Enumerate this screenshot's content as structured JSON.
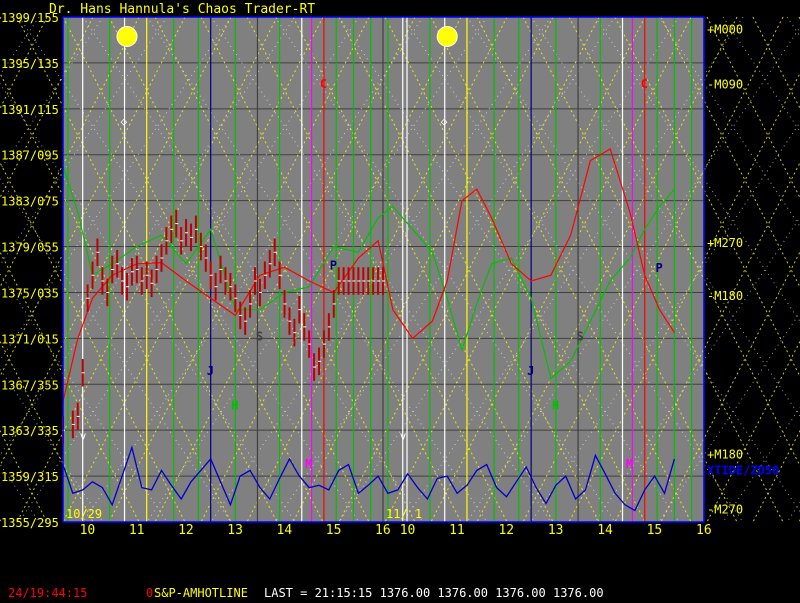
{
  "app": {
    "title": "Dr. Hans Hannula's Chaos Trader-RT"
  },
  "colors": {
    "background": "#000000",
    "plot_bg": "#808080",
    "price_label": "#ffff00",
    "price_line": "#ffffff",
    "price_bars": "#c00000",
    "red_curve": "#ff0000",
    "green_curve": "#00c000",
    "tide_curve": "#0000cc",
    "grid_yellow": "#ffff00",
    "grid_white": "#ffffff",
    "axis_blue": "#0000ff",
    "green_vline": "#00c000",
    "magenta_vline": "#ff00ff",
    "red_vline": "#ff0000",
    "navy_vline": "#000080",
    "dark_vline": "#404040"
  },
  "chart_data": {
    "type": "line",
    "ylim": [
      1355,
      1399
    ],
    "y_tick_labels": [
      "1399/155",
      "1395/135",
      "1391/115",
      "1387/095",
      "1383/075",
      "1379/055",
      "1375/035",
      "1371/015",
      "1367/355",
      "1363/335",
      "1359/315",
      "1355/295"
    ],
    "y_tick_values": [
      1399,
      1395,
      1391,
      1387,
      1383,
      1379,
      1375,
      1371,
      1367,
      1363,
      1359,
      1355
    ],
    "x_date_labels": [
      "10/29",
      "11/ 1"
    ],
    "x_hour_labels": [
      "10",
      "11",
      "12",
      "13",
      "14",
      "15",
      "16",
      "10",
      "11",
      "12",
      "13",
      "14",
      "15",
      "16"
    ],
    "right_labels": [
      {
        "text": "+M000",
        "price": 1397.9
      },
      {
        "text": "-M090",
        "price": 1393.1
      },
      {
        "text": "+M270",
        "price": 1379.3
      },
      {
        "text": "-M180",
        "price": 1374.7
      },
      {
        "text": "+M180",
        "price": 1360.9
      },
      {
        "text": "XTIDE/ZD50",
        "price": 1359.5
      },
      {
        "text": "-M270",
        "price": 1356.1
      }
    ],
    "markers": [
      {
        "text": "C",
        "x": 14.8,
        "price": 1392.8,
        "color": "#ff0000"
      },
      {
        "text": "P",
        "x": 15.0,
        "price": 1377.0,
        "color": "#000080"
      },
      {
        "text": "S",
        "x": 13.5,
        "price": 1370.8,
        "color": "#404040"
      },
      {
        "text": "J",
        "x": 12.5,
        "price": 1367.8,
        "color": "#000080"
      },
      {
        "text": "H",
        "x": 13.0,
        "price": 1364.8,
        "color": "#00c000"
      },
      {
        "text": "M",
        "x": 14.5,
        "price": 1359.7,
        "color": "#ff00ff"
      },
      {
        "text": "C",
        "x": 14.8,
        "price": 1392.8,
        "color": "#ff0000",
        "day": 2
      },
      {
        "text": "P",
        "x": 15.1,
        "price": 1376.8,
        "color": "#000080",
        "day": 2
      },
      {
        "text": "S",
        "x": 13.5,
        "price": 1370.8,
        "color": "#404040",
        "day": 2
      },
      {
        "text": "J",
        "x": 12.5,
        "price": 1367.8,
        "color": "#000080",
        "day": 2
      },
      {
        "text": "H",
        "x": 13.0,
        "price": 1364.8,
        "color": "#00c000",
        "day": 2
      },
      {
        "text": "M",
        "x": 14.5,
        "price": 1359.7,
        "color": "#ff00ff",
        "day": 2
      }
    ],
    "moon_phases": [
      {
        "x": 10.8,
        "price": 1397.3
      },
      {
        "x": 10.8,
        "price": 1397.3,
        "day": 2
      }
    ],
    "series": [
      {
        "name": "price",
        "x": [
          9.5,
          9.7,
          9.8,
          9.9,
          10.0,
          10.1,
          10.2,
          10.3,
          10.4,
          10.5,
          10.6,
          10.7,
          10.8,
          10.9,
          11.0,
          11.1,
          11.2,
          11.3,
          11.4,
          11.5,
          11.6,
          11.7,
          11.8,
          11.9,
          12.0,
          12.1,
          12.2,
          12.3,
          12.4,
          12.5,
          12.6,
          12.7,
          12.8,
          12.9,
          13.0,
          13.1,
          13.2,
          13.3,
          13.4,
          13.5,
          13.6,
          13.7,
          13.8,
          13.9,
          14.0,
          14.1,
          14.2,
          14.3,
          14.4,
          14.5,
          14.6,
          14.7,
          14.8,
          14.9,
          15.0,
          15.1,
          15.2,
          15.3,
          15.4,
          15.5,
          15.6,
          15.7,
          15.8,
          15.9,
          16.0
        ],
        "values": [
          1363.0,
          1363.5,
          1364.2,
          1368.0,
          1374.5,
          1376.5,
          1378.5,
          1376.0,
          1375.0,
          1377.0,
          1377.5,
          1376.0,
          1375.5,
          1376.8,
          1377.0,
          1376.0,
          1376.5,
          1375.8,
          1377.0,
          1378.0,
          1379.5,
          1380.5,
          1381.0,
          1379.5,
          1380.2,
          1379.8,
          1380.5,
          1379.0,
          1378.0,
          1376.5,
          1375.5,
          1377.0,
          1376.0,
          1375.5,
          1374.5,
          1373.0,
          1372.5,
          1374.0,
          1376.0,
          1375.0,
          1376.5,
          1377.5,
          1378.5,
          1376.5,
          1374.0,
          1372.5,
          1371.5,
          1373.5,
          1372.0,
          1370.5,
          1368.5,
          1369.0,
          1370.5,
          1372.0,
          1374.0,
          1376.0,
          1376.0,
          1376.0,
          1376.0,
          1376.0,
          1376.0,
          1376.0,
          1376.0,
          1376.0,
          1376.0
        ]
      },
      {
        "name": "red-cycle",
        "x": [
          9.5,
          9.8,
          10.1,
          10.5,
          11.0,
          11.5,
          12.0,
          12.5,
          13.0,
          13.5,
          14.0,
          14.5,
          15.0,
          15.5,
          15.9,
          16.2,
          16.6,
          17.0,
          17.3,
          17.6,
          17.9,
          18.2,
          18.6,
          19.0,
          19.4,
          19.8,
          20.2,
          20.6,
          21.0,
          21.3,
          21.6,
          21.9
        ],
        "values": [
          1365.5,
          1371.0,
          1374.5,
          1376.5,
          1377.5,
          1377.6,
          1376.0,
          1374.5,
          1373.0,
          1376.5,
          1377.2,
          1376.0,
          1375.0,
          1378.0,
          1379.5,
          1373.5,
          1371.0,
          1372.5,
          1376.0,
          1383.0,
          1384.0,
          1381.5,
          1377.5,
          1376.0,
          1376.5,
          1380.0,
          1386.5,
          1387.5,
          1382.0,
          1376.5,
          1373.5,
          1371.5
        ]
      },
      {
        "name": "green-cycle",
        "x": [
          9.5,
          9.8,
          10.1,
          10.5,
          11.0,
          11.5,
          12.0,
          12.5,
          13.0,
          13.5,
          14.0,
          14.5,
          15.0,
          15.5,
          15.9,
          16.2,
          16.6,
          17.0,
          17.3,
          17.6,
          17.9,
          18.2,
          18.6,
          19.0,
          19.4,
          19.8,
          20.2,
          20.6,
          21.0,
          21.3,
          21.6,
          21.9
        ],
        "values": [
          1386.0,
          1382.0,
          1376.5,
          1377.5,
          1379.0,
          1380.0,
          1377.5,
          1380.5,
          1373.5,
          1373.5,
          1375.0,
          1375.5,
          1379.0,
          1378.5,
          1381.5,
          1382.5,
          1380.5,
          1378.5,
          1374.5,
          1370.0,
          1374.0,
          1377.5,
          1378.0,
          1374.5,
          1367.5,
          1369.0,
          1372.5,
          1376.0,
          1378.0,
          1380.5,
          1382.5,
          1384.0
        ]
      },
      {
        "name": "tide",
        "x": [
          9.5,
          9.7,
          9.9,
          10.1,
          10.3,
          10.5,
          10.7,
          10.9,
          11.1,
          11.3,
          11.5,
          11.7,
          11.9,
          12.1,
          12.3,
          12.5,
          12.7,
          12.9,
          13.1,
          13.3,
          13.5,
          13.7,
          13.9,
          14.1,
          14.3,
          14.5,
          14.7,
          14.9,
          15.1,
          15.3,
          15.5,
          15.7,
          15.9,
          16.1,
          16.3,
          16.5,
          16.7,
          16.9,
          17.1,
          17.3,
          17.5,
          17.7,
          17.9,
          18.1,
          18.3,
          18.5,
          18.7,
          18.9,
          19.1,
          19.3,
          19.5,
          19.7,
          19.9,
          20.1,
          20.3,
          20.5,
          20.7,
          20.9,
          21.1,
          21.3,
          21.5,
          21.7,
          21.9
        ],
        "values": [
          1360.0,
          1357.5,
          1357.8,
          1358.5,
          1358.0,
          1356.5,
          1359.0,
          1361.5,
          1358.0,
          1357.8,
          1359.5,
          1358.2,
          1357.0,
          1358.5,
          1359.5,
          1360.5,
          1358.5,
          1356.5,
          1359.0,
          1359.5,
          1358.0,
          1357.0,
          1358.8,
          1360.5,
          1359.0,
          1358.0,
          1358.2,
          1357.8,
          1359.5,
          1360.0,
          1357.5,
          1358.2,
          1359.0,
          1357.5,
          1357.8,
          1359.2,
          1358.0,
          1357.0,
          1358.8,
          1359.0,
          1357.5,
          1358.2,
          1359.5,
          1360.0,
          1358.0,
          1357.2,
          1358.5,
          1359.8,
          1358.0,
          1356.6,
          1358.2,
          1359.0,
          1357.0,
          1357.8,
          1360.8,
          1359.2,
          1357.5,
          1356.5,
          1356.0,
          1357.8,
          1359.0,
          1357.5,
          1360.5
        ]
      }
    ]
  },
  "status": {
    "timestamp": "24/19:44:15",
    "flag": "0",
    "feed": "S&P-AMHOTLINE",
    "quote": "LAST = 21:15:15  1376.00  1376.00  1376.00  1376.00"
  }
}
